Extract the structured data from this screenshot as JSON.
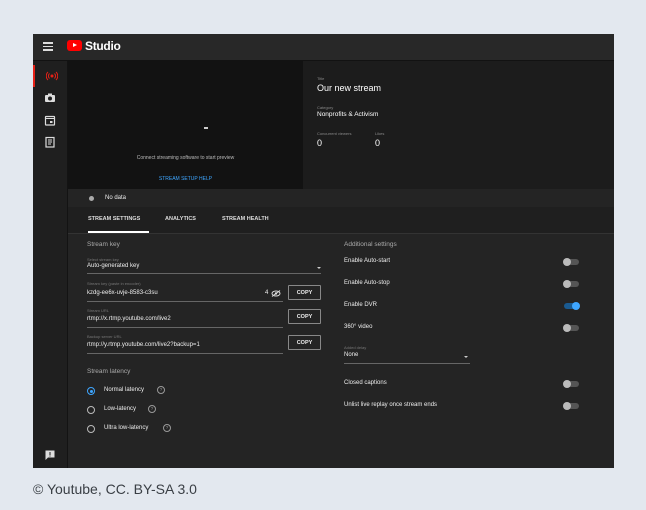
{
  "app": {
    "name": "Studio"
  },
  "preview": {
    "message": "Connect streaming software to start preview",
    "help_link": "STREAM SETUP HELP"
  },
  "stream_info": {
    "title_label": "Title",
    "title": "Our new stream",
    "category_label": "Category",
    "category": "Nonprofits & Activism",
    "viewers_label": "Concurrent viewers",
    "viewers": "0",
    "likes_label": "Likes",
    "likes": "0"
  },
  "status": {
    "text": "No data"
  },
  "tabs": [
    {
      "label": "STREAM SETTINGS",
      "active": true
    },
    {
      "label": "ANALYTICS",
      "active": false
    },
    {
      "label": "STREAM HEALTH",
      "active": false
    }
  ],
  "stream_key": {
    "heading": "Stream key",
    "select_label": "Select stream key",
    "select_value": "Auto-generated key",
    "key_label": "Stream key (paste in encoder)",
    "key_value": "kzdg-ee6x-uvje-8583-c3su",
    "key_reveal_count": "4",
    "url_label": "Stream URL",
    "url_value": "rtmp://x.rtmp.youtube.com/live2",
    "backup_label": "Backup server URL",
    "backup_value": "rtmp://y.rtmp.youtube.com/live2?backup=1",
    "copy_label": "COPY"
  },
  "latency": {
    "heading": "Stream latency",
    "options": [
      {
        "label": "Normal latency",
        "selected": true
      },
      {
        "label": "Low-latency",
        "selected": false
      },
      {
        "label": "Ultra low-latency",
        "selected": false
      }
    ],
    "help_glyph": "?"
  },
  "additional": {
    "heading": "Additional settings",
    "settings": [
      {
        "label": "Enable Auto-start",
        "on": false
      },
      {
        "label": "Enable Auto-stop",
        "on": false
      },
      {
        "label": "Enable DVR",
        "on": true
      },
      {
        "label": "360° video",
        "on": false
      }
    ],
    "delay_label": "Added delay",
    "delay_value": "None",
    "settings2": [
      {
        "label": "Closed captions",
        "on": false
      },
      {
        "label": "Unlist live replay once stream ends",
        "on": false
      }
    ]
  },
  "sidebar": {
    "items": [
      {
        "icon": "live-broadcast-icon",
        "active": true
      },
      {
        "icon": "camera-icon",
        "active": false
      },
      {
        "icon": "calendar-icon",
        "active": false
      },
      {
        "icon": "manage-icon",
        "active": false
      },
      {
        "icon": "feedback-icon",
        "active": false
      }
    ]
  },
  "colors": {
    "accent": "#3ea6ff",
    "brand": "#ff0000",
    "background": "#1c1c1c"
  },
  "caption": "© Youtube, CC. BY-SA 3.0"
}
